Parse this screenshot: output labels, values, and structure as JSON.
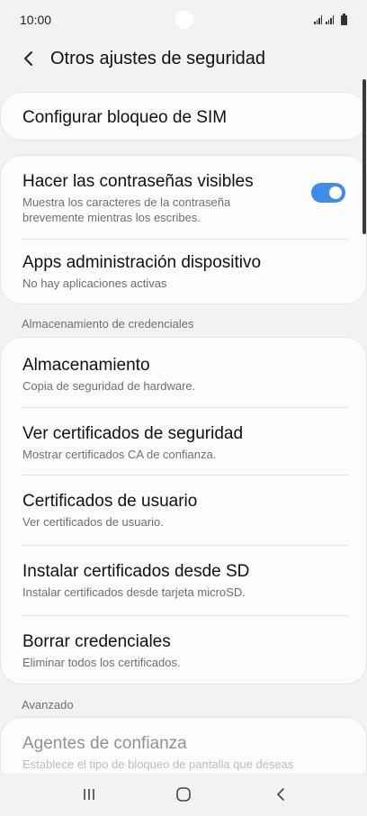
{
  "status_bar": {
    "time": "10:00"
  },
  "header": {
    "title": "Otros ajustes de seguridad"
  },
  "groups": [
    {
      "items": [
        {
          "title": "Configurar bloqueo de SIM",
          "subtitle": ""
        }
      ]
    },
    {
      "items": [
        {
          "title": "Hacer las contraseñas visibles",
          "subtitle_line1": "Muestra los caracteres de la contraseña",
          "subtitle_line2": "brevemente mientras los escribes.",
          "toggle_on": true
        },
        {
          "title": "Apps administración dispositivo",
          "subtitle": "No hay aplicaciones activas"
        }
      ]
    },
    {
      "header": "Almacenamiento de credenciales",
      "items": [
        {
          "title": "Almacenamiento",
          "subtitle": "Copia de seguridad de hardware."
        },
        {
          "title": "Ver certificados de seguridad",
          "subtitle": "Mostrar certificados CA de confianza."
        },
        {
          "title": "Certificados de usuario",
          "subtitle": "Ver certificados de usuario."
        },
        {
          "title": "Instalar certificados desde SD",
          "subtitle": "Instalar certificados desde tarjeta microSD."
        },
        {
          "title": "Borrar credenciales",
          "subtitle": "Eliminar todos los certificados."
        }
      ]
    },
    {
      "header": "Avanzado",
      "items": [
        {
          "title": "Agentes de confianza",
          "subtitle": "Establece el tipo de bloqueo de pantalla que deseas"
        }
      ]
    }
  ],
  "nav_bar": {
    "icons": [
      "recents-icon",
      "home-icon",
      "back-icon"
    ]
  },
  "colors": {
    "accent": "#3e8ee8",
    "background": "#f2f2f2",
    "card": "#fcfcfc"
  }
}
